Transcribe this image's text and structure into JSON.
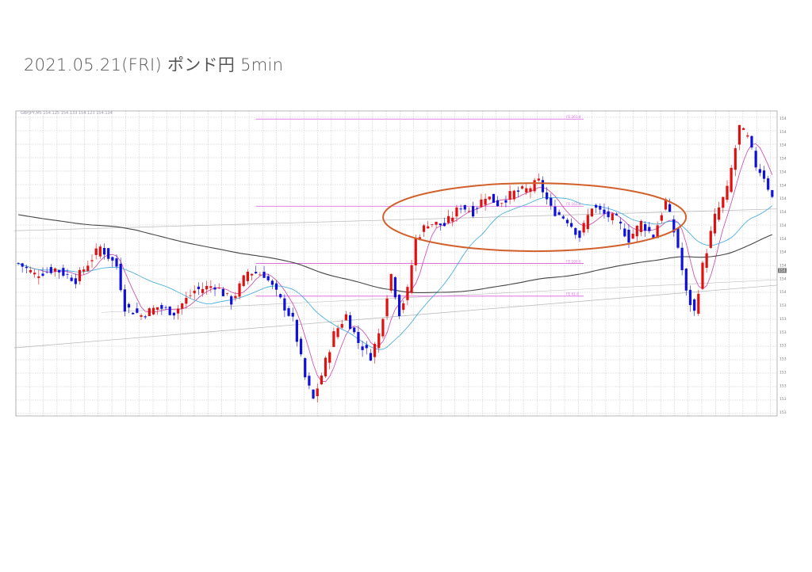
{
  "page": {
    "title": "2021.05.21(FRI)  ポンド円 5min"
  },
  "chart_data": {
    "type": "candlestick",
    "timeframe": "5min",
    "ylim": [
      153.6,
      154.72
    ],
    "price_axis_ticks": [
      "154.680",
      "154.630",
      "154.585",
      "154.530",
      "154.480",
      "154.435",
      "154.385",
      "154.330",
      "154.280",
      "154.230",
      "154.185",
      "154.130",
      "154.080",
      "154.030",
      "153.985",
      "153.930",
      "153.880",
      "153.830",
      "153.785",
      "153.730",
      "153.680",
      "153.635",
      "153.580"
    ],
    "current_price_label": "154.134",
    "fib_levels": [
      {
        "label": "FE 261.8",
        "value": 154.69
      },
      {
        "label": "FE 161.8",
        "value": 154.37
      },
      {
        "label": "FE 100.0",
        "value": 154.16
      },
      {
        "label": "FE 61.8",
        "value": 154.04
      }
    ],
    "ohlc_info": "GBPJPY,M5  154.125 154.133 154.123 154.134",
    "highlight": {
      "shape": "ellipse",
      "color": "#d2602a"
    },
    "colors": {
      "bull": "#e01010",
      "bear": "#1010dd",
      "ma_fast": "#cc44aa",
      "ma_mid": "#3aa8dd",
      "ma_slow": "#444444",
      "trend": "#bbbbbb",
      "fib": "#e070e0"
    },
    "close_path": [
      [
        0,
        154.16
      ],
      [
        4,
        154.12
      ],
      [
        9,
        154.14
      ],
      [
        14,
        154.1
      ],
      [
        20,
        154.22
      ],
      [
        24,
        154.15
      ],
      [
        26,
        154.0
      ],
      [
        30,
        153.97
      ],
      [
        34,
        154.0
      ],
      [
        38,
        153.98
      ],
      [
        43,
        154.06
      ],
      [
        48,
        154.08
      ],
      [
        52,
        154.02
      ],
      [
        56,
        154.13
      ],
      [
        60,
        154.12
      ],
      [
        63,
        154.05
      ],
      [
        67,
        153.95
      ],
      [
        70,
        153.74
      ],
      [
        72,
        153.66
      ],
      [
        74,
        153.75
      ],
      [
        77,
        153.9
      ],
      [
        80,
        153.97
      ],
      [
        83,
        153.87
      ],
      [
        86,
        153.82
      ],
      [
        88,
        153.9
      ],
      [
        91,
        154.12
      ],
      [
        93,
        153.98
      ],
      [
        95,
        154.06
      ],
      [
        97,
        154.25
      ],
      [
        100,
        154.31
      ],
      [
        104,
        154.3
      ],
      [
        108,
        154.37
      ],
      [
        111,
        154.35
      ],
      [
        114,
        154.41
      ],
      [
        117,
        154.38
      ],
      [
        121,
        154.42
      ],
      [
        124,
        154.43
      ],
      [
        127,
        154.46
      ],
      [
        130,
        154.36
      ],
      [
        134,
        154.32
      ],
      [
        137,
        154.26
      ],
      [
        140,
        154.37
      ],
      [
        143,
        154.34
      ],
      [
        146,
        154.32
      ],
      [
        149,
        154.25
      ],
      [
        152,
        154.31
      ],
      [
        155,
        154.26
      ],
      [
        158,
        154.39
      ],
      [
        161,
        154.22
      ],
      [
        163,
        154.05
      ],
      [
        165,
        153.98
      ],
      [
        167,
        154.15
      ],
      [
        170,
        154.33
      ],
      [
        173,
        154.43
      ],
      [
        176,
        154.66
      ],
      [
        178,
        154.62
      ],
      [
        180,
        154.52
      ],
      [
        182,
        154.48
      ],
      [
        184,
        154.4
      ]
    ],
    "y_values_note": "x = candle index (185 candles), y = price"
  }
}
